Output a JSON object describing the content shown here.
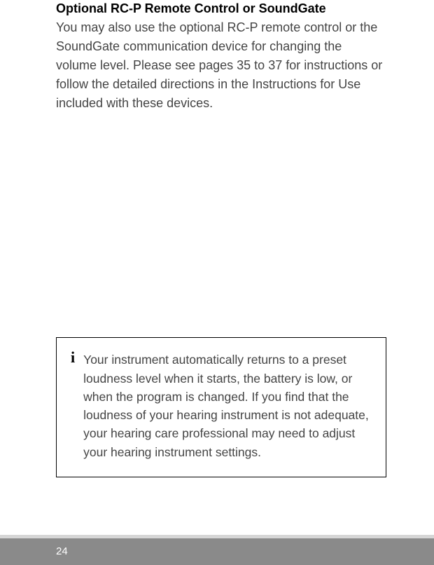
{
  "page": {
    "heading": "Optional RC-P Remote Control or SoundGate",
    "body": "You may also use the optional RC-P remote control or the SoundGate communication device for changing the volume level. Please see pages 35 to 37 for instructions or follow the detailed directions in the Instructions for Use included with these devices."
  },
  "info_box": {
    "icon": "i",
    "text": "Your instrument automatically returns to a preset loudness level when it starts, the battery is low, or when the program is changed. If you find that the loudness of your hearing instrument is not adequate, your hearing care professional may need to adjust your hearing instrument settings."
  },
  "footer": {
    "page_number": "24"
  }
}
